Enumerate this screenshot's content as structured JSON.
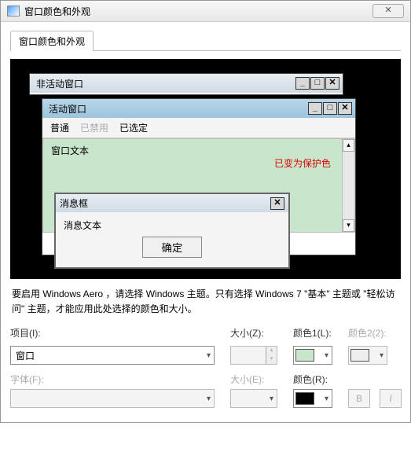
{
  "window": {
    "title": "窗口颜色和外观",
    "close_glyph": "✕"
  },
  "tab": {
    "label": "窗口颜色和外观"
  },
  "preview": {
    "inactive_title": "非活动窗口",
    "active_title": "活动窗口",
    "menu": {
      "normal": "普通",
      "disabled": "已禁用",
      "selected": "已选定"
    },
    "body_text": "窗口文本",
    "protect_text": "已变为保护色",
    "msgbox": {
      "title": "消息框",
      "text": "消息文本",
      "ok": "确定"
    },
    "minimize": "_",
    "maximize": "□",
    "close": "✕"
  },
  "description": "要启用 Windows Aero ，请选择 Windows 主题。只有选择 Windows 7 \"基本\" 主题或 \"轻松访问\" 主题，才能应用此处选择的颜色和大小。",
  "form": {
    "item_label": "项目(I):",
    "item_value": "窗口",
    "size_z_label": "大小(Z):",
    "size_z_value": "",
    "color1_label": "颜色1(L):",
    "color1_value": "#c8e6cc",
    "color2_label": "颜色2(2):",
    "font_label": "字体(F):",
    "font_value": "",
    "size_e_label": "大小(E):",
    "size_e_value": "",
    "color_r_label": "颜色(R):",
    "color_r_value": "#000000",
    "bold": "B",
    "italic": "I"
  }
}
